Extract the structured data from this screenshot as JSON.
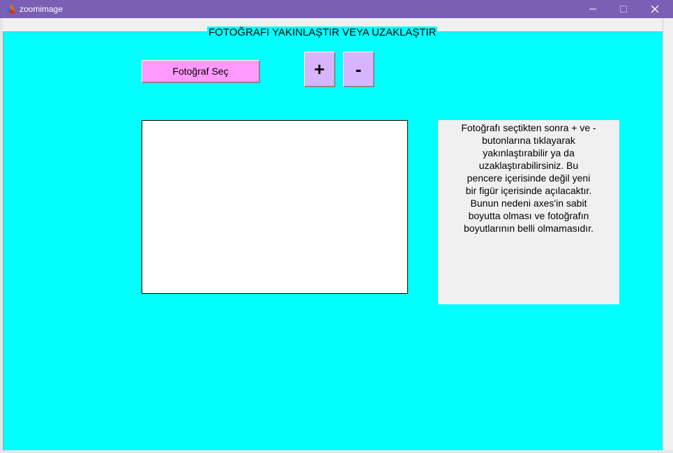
{
  "window": {
    "title": "zoomimage",
    "accent_color": "#7a5fb5"
  },
  "panel": {
    "title": "FOTOĞRAFI YAKINLAŞTIR VEYA UZAKLAŞTIR",
    "background_color": "#00ffff"
  },
  "buttons": {
    "select_photo_label": "Fotoğraf Seç",
    "zoom_in_label": "+",
    "zoom_out_label": "-",
    "select_photo_color": "#ff99ff",
    "zoom_color": "#d8b4fe"
  },
  "info": {
    "text_lines": [
      "Fotoğrafı seçtikten sonra + ve -",
      "butonlarına tıklayarak",
      "yakınlaştırabilir ya da",
      "uzaklaştırabilirsiniz. Bu",
      "pencere içerisinde değil yeni",
      "bir figür içerisinde açılacaktır.",
      "Bunun nedeni axes'in sabit",
      "boyutta olması ve fotoğrafın",
      "boyutlarının belli olmamasıdır."
    ]
  },
  "icons": {
    "app": "matlab-icon",
    "minimize": "minimize-icon",
    "maximize": "maximize-icon",
    "close": "close-icon"
  }
}
